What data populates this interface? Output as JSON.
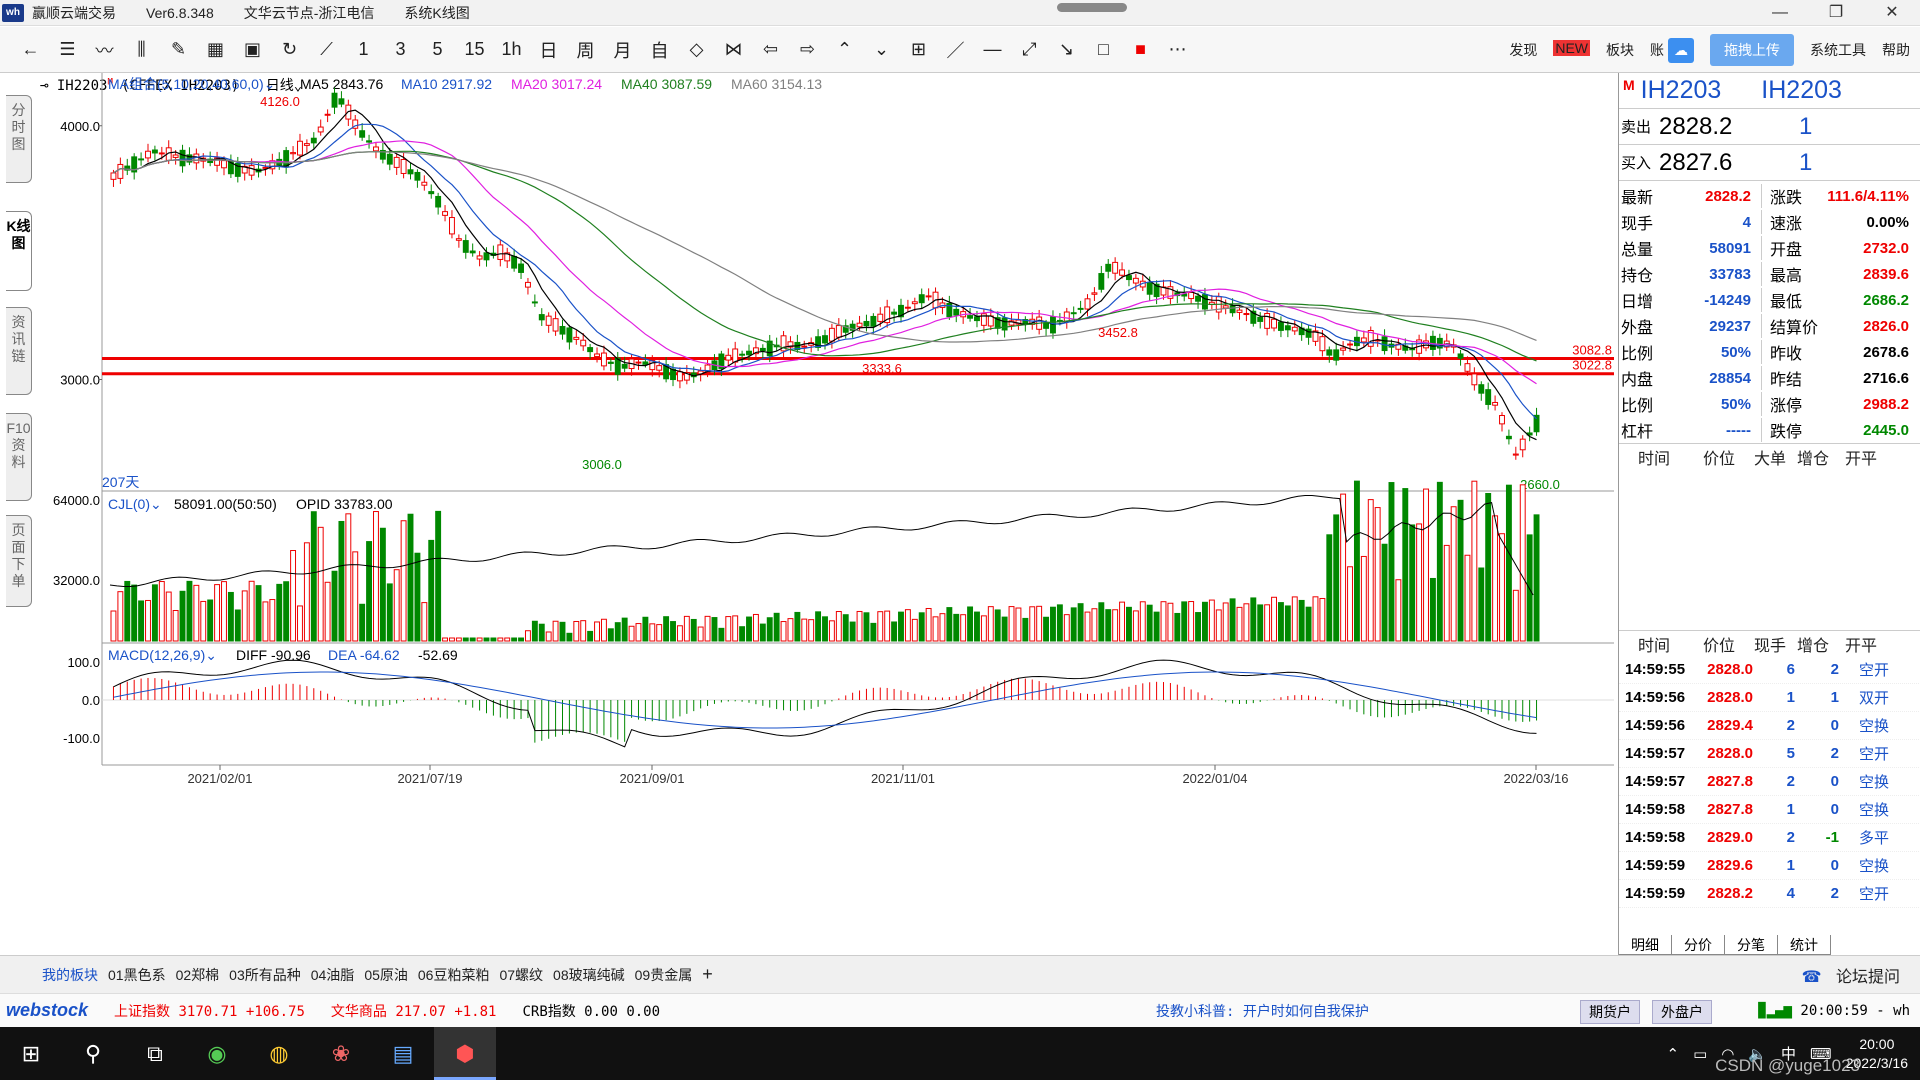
{
  "titlebar": {
    "logo": "wh",
    "app": "赢顺云端交易",
    "version": "Ver6.8.348",
    "node": "文华云节点-浙江电信",
    "view": "系统K线图",
    "controls": [
      "—",
      "❐",
      "✕"
    ]
  },
  "toolbar": {
    "period_buttons": [
      "1",
      "3",
      "5",
      "15",
      "1h",
      "日",
      "周",
      "月",
      "自"
    ],
    "right": {
      "discover": "发现",
      "new_badge": "NEW",
      "board": "板块",
      "account": "账",
      "upload": "拖拽上传",
      "system_tools": "系统工具",
      "help": "帮助"
    }
  },
  "left_tabs": [
    "分时图",
    "K线图",
    "资讯链",
    "F10资料",
    "页面下单"
  ],
  "chart_header": {
    "symbol": "IH2203",
    "sup": "M",
    "exchange": "(CFFEX IH2203)",
    "period": "日线"
  },
  "chart_data": {
    "type": "candlestick",
    "ma_title": "MA组合(5,10,20,40,60,0)",
    "ma_values": [
      {
        "name": "MA5",
        "value": "2843.76",
        "color": "#000000"
      },
      {
        "name": "MA10",
        "value": "2917.92",
        "color": "#1a52c8"
      },
      {
        "name": "MA20",
        "value": "3017.24",
        "color": "#e020e0"
      },
      {
        "name": "MA40",
        "value": "3087.59",
        "color": "#208020"
      },
      {
        "name": "MA60",
        "value": "3154.13",
        "color": "#808080"
      }
    ],
    "price_axis": [
      "4000.0",
      "3000.0"
    ],
    "annotations": {
      "high": "4126.0",
      "low1": "3006.0",
      "mid1": "3333.6",
      "mid2": "3452.8",
      "low2": "2660.0",
      "days": "207天"
    },
    "hlines": [
      {
        "label": "3082.8",
        "value": 3082.8
      },
      {
        "label": "3022.8",
        "value": 3022.8
      }
    ],
    "volume_title": "CJL(0)",
    "volume_text": "58091.00(50:50)",
    "opid_text": "OPID 33783.00",
    "volume_axis": [
      "64000.0",
      "32000.0"
    ],
    "macd_title": "MACD(12,26,9)",
    "macd_diff": "DIFF -90.96",
    "macd_dea": "DEA -64.62",
    "macd_val": "-52.69",
    "macd_axis": [
      "100.0",
      "0.0",
      "-100.0"
    ],
    "dates": [
      "2021/02/01",
      "2021/07/19",
      "2021/09/01",
      "2021/11/01",
      "2022/01/04",
      "2022/03/16"
    ],
    "close_path": [
      3800,
      3850,
      3900,
      3880,
      3870,
      3860,
      3830,
      3820,
      3850,
      3900,
      3950,
      4126,
      3990,
      3900,
      3850,
      3800,
      3700,
      3550,
      3480,
      3500,
      3450,
      3250,
      3200,
      3150,
      3080,
      3050,
      3070,
      3040,
      3006,
      3030,
      3080,
      3100,
      3120,
      3140,
      3130,
      3160,
      3200,
      3220,
      3250,
      3280,
      3333,
      3280,
      3250,
      3230,
      3220,
      3230,
      3210,
      3250,
      3300,
      3452,
      3400,
      3360,
      3340,
      3330,
      3300,
      3280,
      3250,
      3220,
      3200,
      3180,
      3090,
      3150,
      3160,
      3130,
      3120,
      3150,
      3130,
      2990,
      2900,
      2700,
      2830
    ]
  },
  "quote": {
    "sup": "M",
    "symbol1": "IH2203",
    "symbol2": "IH2203",
    "sell_label": "卖出",
    "sell_price": "2828.2",
    "sell_vol": "1",
    "buy_label": "买入",
    "buy_price": "2827.6",
    "buy_vol": "1",
    "rows": [
      {
        "k": "最新",
        "v": "2828.2",
        "vc": "red",
        "k2": "涨跌",
        "v2": "111.6/4.11%",
        "v2c": "red"
      },
      {
        "k": "现手",
        "v": "4",
        "vc": "blue",
        "k2": "速涨",
        "v2": "0.00%",
        "v2c": "black"
      },
      {
        "k": "总量",
        "v": "58091",
        "vc": "blue",
        "k2": "开盘",
        "v2": "2732.0",
        "v2c": "red"
      },
      {
        "k": "持仓",
        "v": "33783",
        "vc": "blue",
        "k2": "最高",
        "v2": "2839.6",
        "v2c": "red"
      },
      {
        "k": "日增",
        "v": "-14249",
        "vc": "blue",
        "k2": "最低",
        "v2": "2686.2",
        "v2c": "green"
      },
      {
        "k": "外盘",
        "v": "29237",
        "vc": "blue",
        "k2": "结算价",
        "v2": "2826.0",
        "v2c": "red"
      },
      {
        "k": "比例",
        "v": "50%",
        "vc": "blue",
        "k2": "昨收",
        "v2": "2678.6",
        "v2c": "black"
      },
      {
        "k": "内盘",
        "v": "28854",
        "vc": "blue",
        "k2": "昨结",
        "v2": "2716.6",
        "v2c": "black"
      },
      {
        "k": "比例",
        "v": "50%",
        "vc": "blue",
        "k2": "涨停",
        "v2": "2988.2",
        "v2c": "red"
      },
      {
        "k": "杠杆",
        "v": "-----",
        "vc": "blue",
        "k2": "跌停",
        "v2": "2445.0",
        "v2c": "green"
      }
    ],
    "big_order_head": [
      "时间",
      "价位",
      "大单",
      "增仓",
      "开平"
    ],
    "tick_head": [
      "时间",
      "价位",
      "现手",
      "增仓",
      "开平"
    ],
    "ticks": [
      {
        "t": "14:59:55",
        "p": "2828.0",
        "n": "6",
        "z": "2",
        "o": "空开"
      },
      {
        "t": "14:59:56",
        "p": "2828.0",
        "n": "1",
        "z": "1",
        "o": "双开"
      },
      {
        "t": "14:59:56",
        "p": "2829.4",
        "n": "2",
        "z": "0",
        "o": "空换"
      },
      {
        "t": "14:59:57",
        "p": "2828.0",
        "n": "5",
        "z": "2",
        "o": "空开"
      },
      {
        "t": "14:59:57",
        "p": "2827.8",
        "n": "2",
        "z": "0",
        "o": "空换"
      },
      {
        "t": "14:59:58",
        "p": "2827.8",
        "n": "1",
        "z": "0",
        "o": "空换"
      },
      {
        "t": "14:59:58",
        "p": "2829.0",
        "n": "2",
        "z": "-1",
        "o": "多平"
      },
      {
        "t": "14:59:59",
        "p": "2829.6",
        "n": "1",
        "z": "0",
        "o": "空换"
      },
      {
        "t": "14:59:59",
        "p": "2828.2",
        "n": "4",
        "z": "2",
        "o": "空开"
      }
    ],
    "tabs": [
      "明细",
      "分价",
      "分笔",
      "统计"
    ]
  },
  "boards": {
    "mine": "我的板块",
    "items": [
      "01黑色系",
      "02郑棉",
      "03所有品种",
      "04油脂",
      "05原油",
      "06豆粕菜粕",
      "07螺纹",
      "08玻璃纯碱",
      "09贵金属"
    ],
    "add": "+",
    "forum": "论坛提问"
  },
  "status": {
    "brand": "webstock",
    "index1": "上证指数 3170.71 +106.75",
    "index2": "文华商品 217.07 +1.81",
    "index3": "CRB指数  0.00 0.00",
    "tip": "投教小科普: 开户时如何自我保护",
    "btn1": "期货户",
    "btn2": "外盘户",
    "clock": "20:00:59 - wh"
  },
  "taskbar": {
    "time": "20:00",
    "date": "2022/3/16",
    "ime": "中",
    "watermark": "CSDN @yuge1023"
  }
}
